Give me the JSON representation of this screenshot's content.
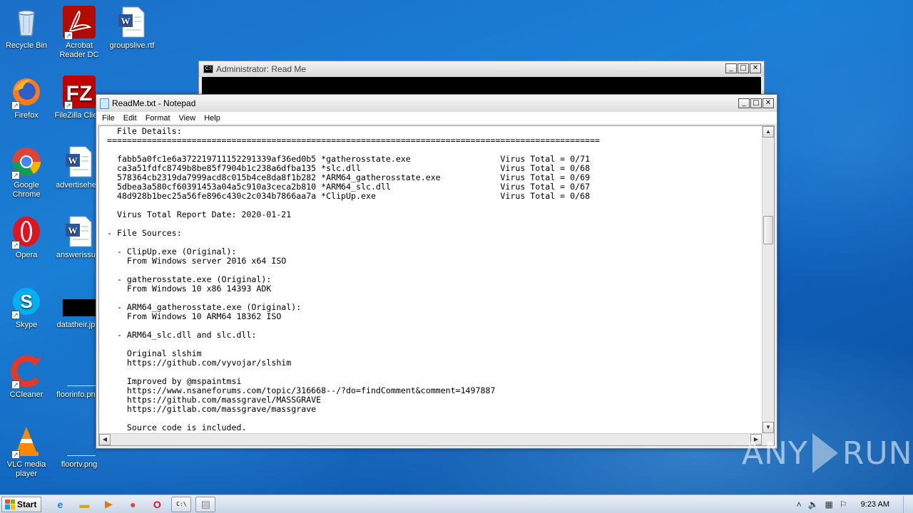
{
  "desktop": {
    "icons": [
      {
        "label": "Recycle Bin"
      },
      {
        "label": "Acrobat Reader DC"
      },
      {
        "label": "groupslive.rtf"
      },
      {
        "label": "Firefox"
      },
      {
        "label": "FileZilla Clie..."
      },
      {
        "label": "Google Chrome"
      },
      {
        "label": "advertisehe..."
      },
      {
        "label": "Opera"
      },
      {
        "label": "answerissu..."
      },
      {
        "label": "Skype"
      },
      {
        "label": "datatheir.jp..."
      },
      {
        "label": "CCleaner"
      },
      {
        "label": "floorinfo.pn..."
      },
      {
        "label": "VLC media player"
      },
      {
        "label": "floortv.png"
      }
    ]
  },
  "cmd": {
    "title": "Administrator:  Read Me"
  },
  "notepad": {
    "title": "ReadMe.txt - Notepad",
    "menu": [
      "File",
      "Edit",
      "Format",
      "View",
      "Help"
    ],
    "text": "  File Details:\n===================================================================================================\n\n  fabb5a0fc1e6a372219711152291339af36ed0b5 *gatherosstate.exe                  Virus Total = 0/71\n  ca3a51fdfc8749b8be85f7904b1c238a6dfba135 *slc.dll                            Virus Total = 0/68\n  578364cb2319da7999acd8c015b4ce8da8f1b282 *ARM64_gatherosstate.exe            Virus Total = 0/69\n  5dbea3a580cf60391453a04a5c910a3ceca2b810 *ARM64_slc.dll                      Virus Total = 0/67\n  48d928b1bec25a56fe896c430c2c034b7866aa7a *ClipUp.exe                         Virus Total = 0/68\n\n  Virus Total Report Date: 2020-01-21\n\n- File Sources:\n\n  - ClipUp.exe (Original):\n    From Windows server 2016 x64 ISO\n\n  - gatherosstate.exe (Original):\n    From Windows 10 x86 14393 ADK\n\n  - ARM64_gatherosstate.exe (Original):\n    From Windows 10 ARM64 18362 ISO\n\n  - ARM64_slc.dll and slc.dll:\n\n    Original slshim\n    https://github.com/vyvojar/slshim\n\n    Improved by @mspaintmsi\n    https://www.nsaneforums.com/topic/316668--/?do=findComment&comment=1497887\n    https://github.com/massgravel/MASSGRAVE\n    https://gitlab.com/massgrave/massgrave\n\n    Source code is included."
  },
  "taskbar": {
    "start_label": "Start",
    "clock": "9:23 AM"
  },
  "watermark": {
    "left": "ANY",
    "right": "RUN"
  }
}
